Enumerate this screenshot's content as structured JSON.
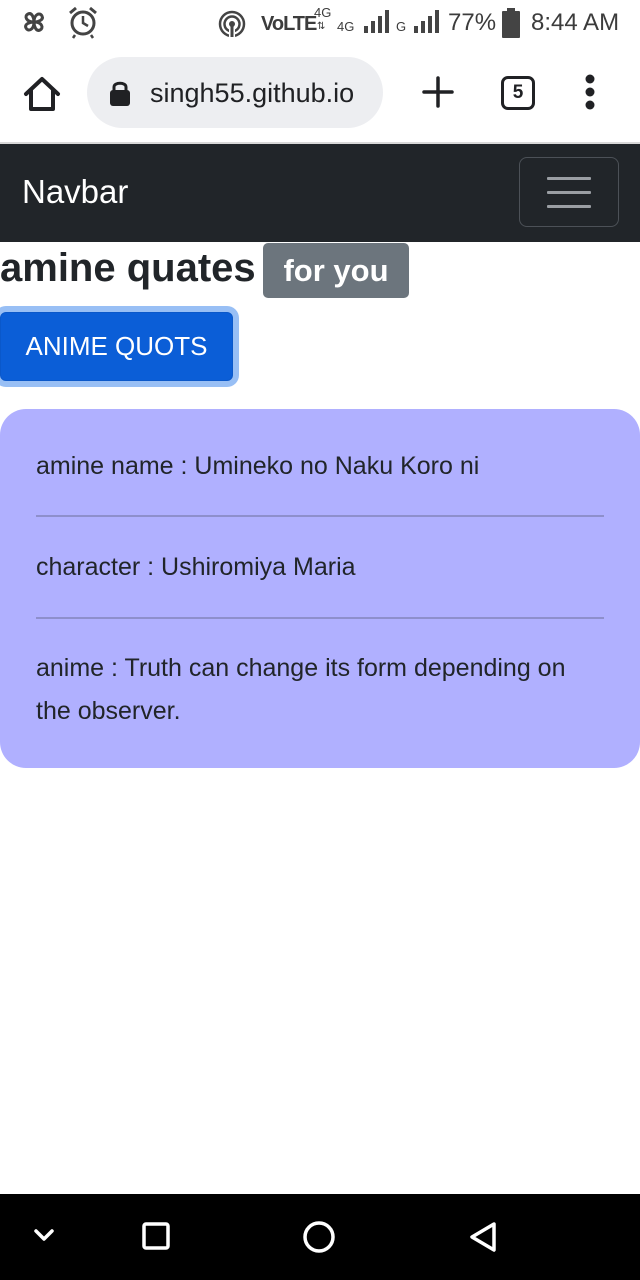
{
  "status_bar": {
    "time": "8:44 AM",
    "battery": "77%",
    "network_volte": "VoLTE",
    "network_4g_top": "4G",
    "network_4g": "4G",
    "network_g": "G",
    "icons": [
      "pinwheel-icon",
      "alarm-icon",
      "hotspot-icon",
      "signal-icon",
      "battery-icon"
    ]
  },
  "browser": {
    "url": "singh55.github.io",
    "tab_count": "5",
    "icons": [
      "home-icon",
      "lock-icon",
      "plus-icon",
      "tabs-icon",
      "more-vert-icon"
    ]
  },
  "navbar": {
    "brand": "Navbar",
    "toggler_icon": "hamburger-icon"
  },
  "heading": {
    "title": "amine quates",
    "badge": "for you"
  },
  "button": {
    "label": "ANIME QUOTS"
  },
  "quote": {
    "anime_name": "amine name : Umineko no Naku Koro ni",
    "character": "character : Ushiromiya Maria",
    "quote": "anime : Truth can change its form depending on the observer."
  },
  "system_nav": {
    "icons": [
      "chevron-down-icon",
      "recents-icon",
      "home-circle-icon",
      "back-icon"
    ]
  },
  "colors": {
    "navbar_bg": "#212529",
    "badge_bg": "#6c757d",
    "button_bg": "#0b5ed7",
    "card_bg": "#b0b0ff"
  }
}
